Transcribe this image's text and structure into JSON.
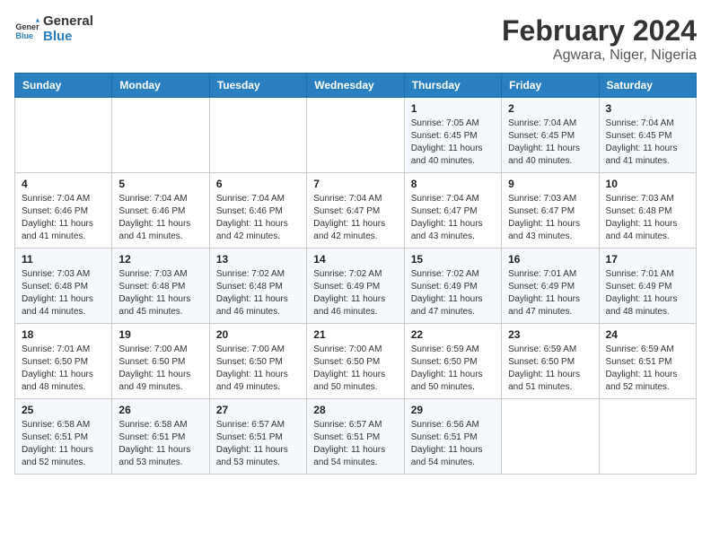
{
  "header": {
    "logo_line1": "General",
    "logo_line2": "Blue",
    "month_title": "February 2024",
    "subtitle": "Agwara, Niger, Nigeria"
  },
  "days_of_week": [
    "Sunday",
    "Monday",
    "Tuesday",
    "Wednesday",
    "Thursday",
    "Friday",
    "Saturday"
  ],
  "weeks": [
    [
      {
        "day": "",
        "info": ""
      },
      {
        "day": "",
        "info": ""
      },
      {
        "day": "",
        "info": ""
      },
      {
        "day": "",
        "info": ""
      },
      {
        "day": "1",
        "info": "Sunrise: 7:05 AM\nSunset: 6:45 PM\nDaylight: 11 hours and 40 minutes."
      },
      {
        "day": "2",
        "info": "Sunrise: 7:04 AM\nSunset: 6:45 PM\nDaylight: 11 hours and 40 minutes."
      },
      {
        "day": "3",
        "info": "Sunrise: 7:04 AM\nSunset: 6:45 PM\nDaylight: 11 hours and 41 minutes."
      }
    ],
    [
      {
        "day": "4",
        "info": "Sunrise: 7:04 AM\nSunset: 6:46 PM\nDaylight: 11 hours and 41 minutes."
      },
      {
        "day": "5",
        "info": "Sunrise: 7:04 AM\nSunset: 6:46 PM\nDaylight: 11 hours and 41 minutes."
      },
      {
        "day": "6",
        "info": "Sunrise: 7:04 AM\nSunset: 6:46 PM\nDaylight: 11 hours and 42 minutes."
      },
      {
        "day": "7",
        "info": "Sunrise: 7:04 AM\nSunset: 6:47 PM\nDaylight: 11 hours and 42 minutes."
      },
      {
        "day": "8",
        "info": "Sunrise: 7:04 AM\nSunset: 6:47 PM\nDaylight: 11 hours and 43 minutes."
      },
      {
        "day": "9",
        "info": "Sunrise: 7:03 AM\nSunset: 6:47 PM\nDaylight: 11 hours and 43 minutes."
      },
      {
        "day": "10",
        "info": "Sunrise: 7:03 AM\nSunset: 6:48 PM\nDaylight: 11 hours and 44 minutes."
      }
    ],
    [
      {
        "day": "11",
        "info": "Sunrise: 7:03 AM\nSunset: 6:48 PM\nDaylight: 11 hours and 44 minutes."
      },
      {
        "day": "12",
        "info": "Sunrise: 7:03 AM\nSunset: 6:48 PM\nDaylight: 11 hours and 45 minutes."
      },
      {
        "day": "13",
        "info": "Sunrise: 7:02 AM\nSunset: 6:48 PM\nDaylight: 11 hours and 46 minutes."
      },
      {
        "day": "14",
        "info": "Sunrise: 7:02 AM\nSunset: 6:49 PM\nDaylight: 11 hours and 46 minutes."
      },
      {
        "day": "15",
        "info": "Sunrise: 7:02 AM\nSunset: 6:49 PM\nDaylight: 11 hours and 47 minutes."
      },
      {
        "day": "16",
        "info": "Sunrise: 7:01 AM\nSunset: 6:49 PM\nDaylight: 11 hours and 47 minutes."
      },
      {
        "day": "17",
        "info": "Sunrise: 7:01 AM\nSunset: 6:49 PM\nDaylight: 11 hours and 48 minutes."
      }
    ],
    [
      {
        "day": "18",
        "info": "Sunrise: 7:01 AM\nSunset: 6:50 PM\nDaylight: 11 hours and 48 minutes."
      },
      {
        "day": "19",
        "info": "Sunrise: 7:00 AM\nSunset: 6:50 PM\nDaylight: 11 hours and 49 minutes."
      },
      {
        "day": "20",
        "info": "Sunrise: 7:00 AM\nSunset: 6:50 PM\nDaylight: 11 hours and 49 minutes."
      },
      {
        "day": "21",
        "info": "Sunrise: 7:00 AM\nSunset: 6:50 PM\nDaylight: 11 hours and 50 minutes."
      },
      {
        "day": "22",
        "info": "Sunrise: 6:59 AM\nSunset: 6:50 PM\nDaylight: 11 hours and 50 minutes."
      },
      {
        "day": "23",
        "info": "Sunrise: 6:59 AM\nSunset: 6:50 PM\nDaylight: 11 hours and 51 minutes."
      },
      {
        "day": "24",
        "info": "Sunrise: 6:59 AM\nSunset: 6:51 PM\nDaylight: 11 hours and 52 minutes."
      }
    ],
    [
      {
        "day": "25",
        "info": "Sunrise: 6:58 AM\nSunset: 6:51 PM\nDaylight: 11 hours and 52 minutes."
      },
      {
        "day": "26",
        "info": "Sunrise: 6:58 AM\nSunset: 6:51 PM\nDaylight: 11 hours and 53 minutes."
      },
      {
        "day": "27",
        "info": "Sunrise: 6:57 AM\nSunset: 6:51 PM\nDaylight: 11 hours and 53 minutes."
      },
      {
        "day": "28",
        "info": "Sunrise: 6:57 AM\nSunset: 6:51 PM\nDaylight: 11 hours and 54 minutes."
      },
      {
        "day": "29",
        "info": "Sunrise: 6:56 AM\nSunset: 6:51 PM\nDaylight: 11 hours and 54 minutes."
      },
      {
        "day": "",
        "info": ""
      },
      {
        "day": "",
        "info": ""
      }
    ]
  ]
}
